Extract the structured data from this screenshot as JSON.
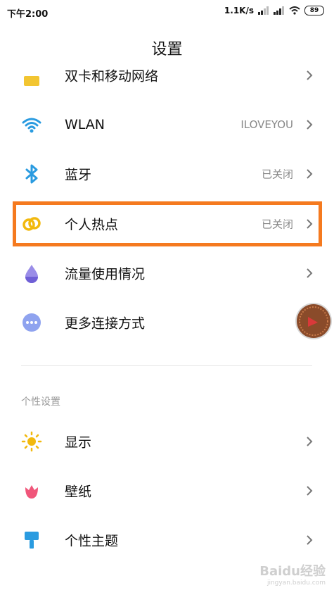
{
  "status_bar": {
    "time": "下午2:00",
    "net_speed": "1.1K/s",
    "battery": "89"
  },
  "header": {
    "title": "设置"
  },
  "rows": [
    {
      "label": "双卡和移动网络",
      "value": "",
      "icon": "sim-icon"
    },
    {
      "label": "WLAN",
      "value": "ILOVEYOU",
      "icon": "wifi-icon"
    },
    {
      "label": "蓝牙",
      "value": "已关闭",
      "icon": "bluetooth-icon"
    },
    {
      "label": "个人热点",
      "value": "已关闭",
      "icon": "hotspot-icon"
    },
    {
      "label": "流量使用情况",
      "value": "",
      "icon": "data-usage-icon"
    },
    {
      "label": "更多连接方式",
      "value": "",
      "icon": "more-connections-icon"
    }
  ],
  "section": {
    "title": "个性设置"
  },
  "rows2": [
    {
      "label": "显示",
      "value": "",
      "icon": "brightness-icon"
    },
    {
      "label": "壁纸",
      "value": "",
      "icon": "wallpaper-icon"
    },
    {
      "label": "个性主题",
      "value": "",
      "icon": "theme-brush-icon"
    }
  ],
  "watermark": {
    "text": "Baidu经验",
    "sub": "jingyan.baidu.com"
  },
  "colors": {
    "highlight": "#f57a1f",
    "accent_blue": "#2a9be0",
    "hotspot_yellow": "#f2b90f"
  }
}
